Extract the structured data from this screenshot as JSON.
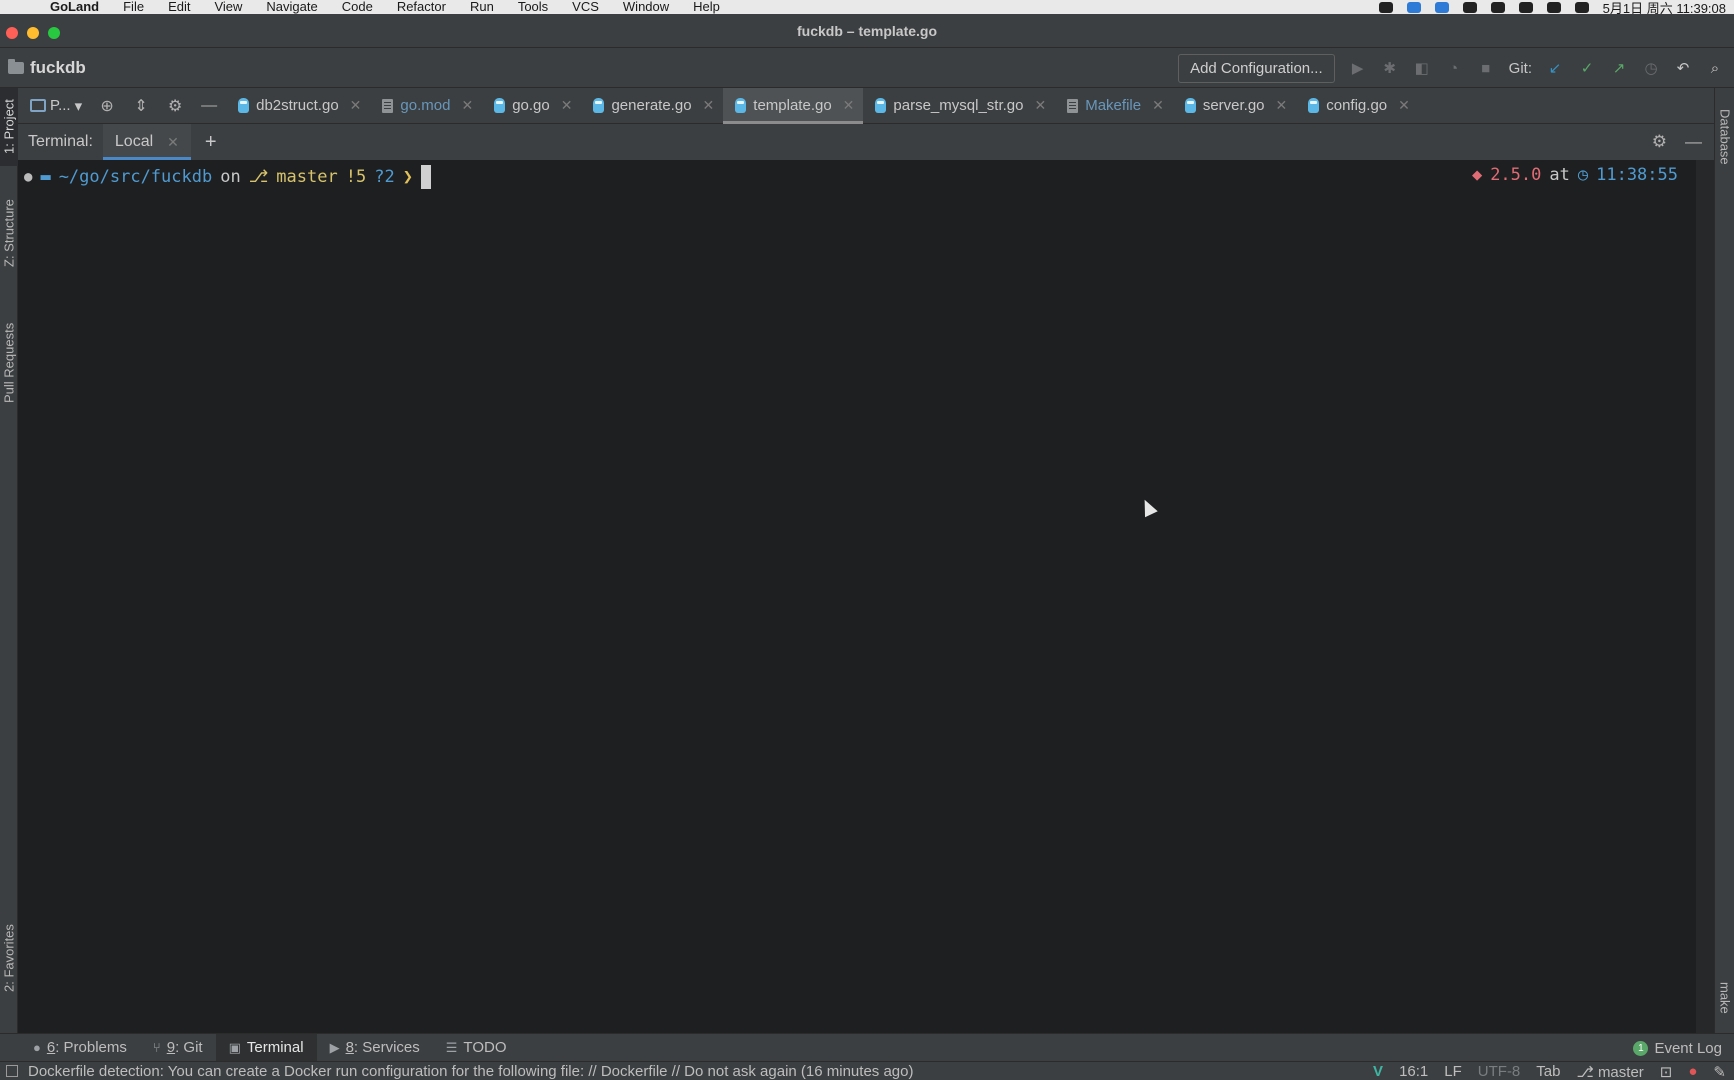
{
  "os_menubar": {
    "app_name": "GoLand",
    "menus": [
      "File",
      "Edit",
      "View",
      "Navigate",
      "Code",
      "Refactor",
      "Run",
      "Tools",
      "VCS",
      "Window",
      "Help"
    ],
    "clock": "5月1日 周六 11:39:08"
  },
  "window": {
    "title": "fuckdb – template.go"
  },
  "navbar": {
    "project_name": "fuckdb",
    "add_configuration": "Add Configuration...",
    "git_label": "Git:"
  },
  "left_stripe": {
    "project": "1: Project",
    "structure": "Z: Structure",
    "pull_requests": "Pull Requests",
    "favorites": "2: Favorites"
  },
  "right_stripe": {
    "database": "Database",
    "make": "make"
  },
  "project_selector": {
    "label": "P..."
  },
  "editor_tabs": [
    {
      "label": "db2struct.go",
      "icon": "go-file-icon",
      "active": false,
      "link": false
    },
    {
      "label": "go.mod",
      "icon": "file-icon",
      "active": false,
      "link": true
    },
    {
      "label": "go.go",
      "icon": "go-file-icon",
      "active": false,
      "link": false
    },
    {
      "label": "generate.go",
      "icon": "go-file-icon",
      "active": false,
      "link": false
    },
    {
      "label": "template.go",
      "icon": "go-file-icon",
      "active": true,
      "link": false
    },
    {
      "label": "parse_mysql_str.go",
      "icon": "go-file-icon",
      "active": false,
      "link": false
    },
    {
      "label": "Makefile",
      "icon": "file-icon",
      "active": false,
      "link": true
    },
    {
      "label": "server.go",
      "icon": "go-file-icon",
      "active": false,
      "link": false
    },
    {
      "label": "config.go",
      "icon": "go-file-icon",
      "active": false,
      "link": false
    }
  ],
  "terminal_header": {
    "label": "Terminal:",
    "tab_label": "Local"
  },
  "terminal": {
    "path": "~/go/src/fuckdb",
    "on": "on",
    "branch": "master",
    "modified": "!5",
    "untracked": "?2",
    "prompt_char": "❯",
    "ruby_version": "2.5.0",
    "at": "at",
    "time": "11:38:55"
  },
  "bottom_tabs": [
    {
      "num": "6",
      "label": ": Problems",
      "active": false
    },
    {
      "num": "9",
      "label": ": Git",
      "active": false
    },
    {
      "num": "",
      "label": "Terminal",
      "active": true
    },
    {
      "num": "8",
      "label": ": Services",
      "active": false
    },
    {
      "num": "",
      "label": "TODO",
      "active": false
    }
  ],
  "event_log": {
    "count": "1",
    "label": "Event Log"
  },
  "statusbar": {
    "message": "Dockerfile detection: You can create a Docker run configuration for the following file: // Dockerfile // Do not ask again (16 minutes ago)",
    "position": "16:1",
    "line_sep": "LF",
    "encoding": "UTF-8",
    "indent": "Tab",
    "branch": "master"
  }
}
